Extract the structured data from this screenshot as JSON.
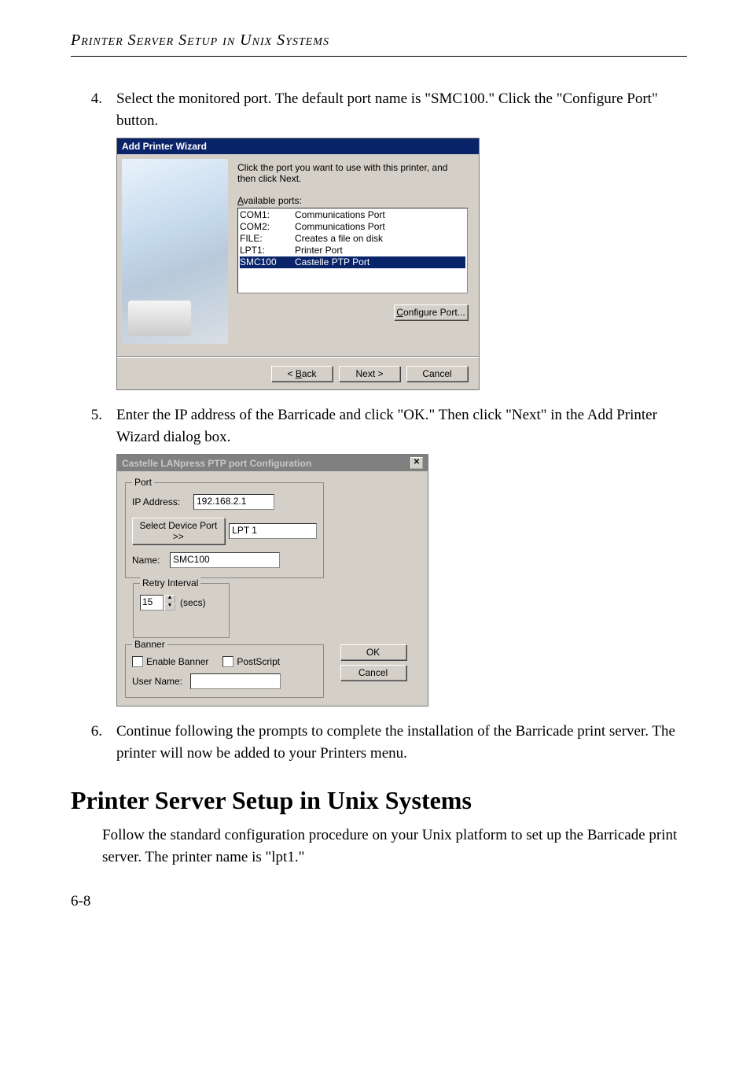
{
  "header": {
    "title": "Printer Server Setup in Unix Systems"
  },
  "steps": {
    "s4": {
      "num": "4.",
      "text": "Select the monitored port. The default port name is \"SMC100.\" Click the \"Configure Port\" button."
    },
    "s5": {
      "num": "5.",
      "text": "Enter the IP address of the Barricade and click \"OK.\" Then click \"Next\" in the Add Printer Wizard dialog box."
    },
    "s6": {
      "num": "6.",
      "text": "Continue following the prompts to complete the installation of the Barricade print server. The printer will now be added to your Printers menu."
    }
  },
  "dialog1": {
    "title": "Add Printer Wizard",
    "instruction": "Click the port you want to use with this printer, and then click Next.",
    "available_label_pre": "A",
    "available_label_post": "vailable ports:",
    "ports": [
      {
        "name": "COM1:",
        "desc": "Communications Port"
      },
      {
        "name": "COM2:",
        "desc": "Communications Port"
      },
      {
        "name": "FILE:",
        "desc": "Creates a file on disk"
      },
      {
        "name": "LPT1:",
        "desc": "Printer Port"
      },
      {
        "name": "SMC100",
        "desc": "Castelle  PTP  Port"
      }
    ],
    "configure_btn_pre": "C",
    "configure_btn_post": "onfigure Port...",
    "back_btn": "< Back",
    "next_btn": "Next >",
    "cancel_btn": "Cancel"
  },
  "dialog2": {
    "title": "Castelle LANpress PTP port  Configuration",
    "port_group": "Port",
    "retry_group": "Retry Interval",
    "banner_group": "Banner",
    "ip_label_pre": "IP ",
    "ip_label_u": "A",
    "ip_label_post": "ddress:",
    "ip_value": "192.168.2.1",
    "select_btn_u": "S",
    "select_btn_post": "elect Device Port >>",
    "lpt_value": "LPT 1",
    "name_label_u": "N",
    "name_label_post": "ame:",
    "name_value": "SMC100",
    "retry_value": "15",
    "retry_units": "(secs)",
    "enable_banner_u": "E",
    "enable_banner_post": "nable Banner",
    "postscript": "PostScript",
    "user_label_u": "U",
    "user_label_post": "ser Name:",
    "user_value": "",
    "ok_btn": "OK",
    "cancel_btn": "Cancel"
  },
  "section": {
    "heading": "Printer Server Setup in Unix Systems",
    "para": "Follow the standard configuration procedure on your Unix platform to set up the Barricade print server. The printer name is \"lpt1.\""
  },
  "page_number": "6-8"
}
